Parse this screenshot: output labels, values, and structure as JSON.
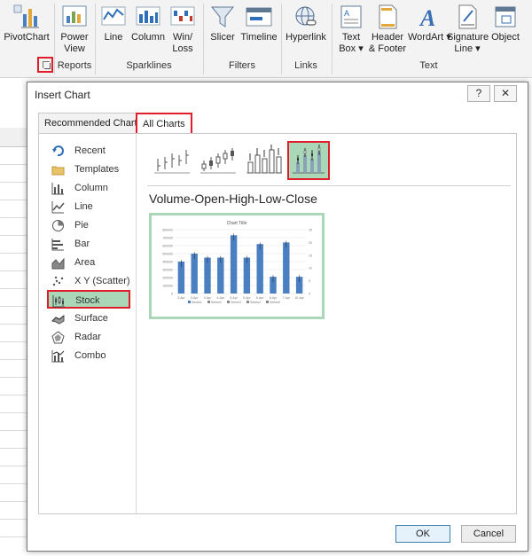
{
  "ribbon": {
    "buttons": [
      {
        "id": "pivotchart",
        "label": "PivotChart",
        "label2": ""
      },
      {
        "id": "power-view",
        "label": "Power",
        "label2": "View"
      },
      {
        "id": "line",
        "label": "Line",
        "label2": ""
      },
      {
        "id": "column",
        "label": "Column",
        "label2": ""
      },
      {
        "id": "winloss",
        "label": "Win/",
        "label2": "Loss"
      },
      {
        "id": "slicer",
        "label": "Slicer",
        "label2": ""
      },
      {
        "id": "timeline",
        "label": "Timeline",
        "label2": ""
      },
      {
        "id": "hyperlink",
        "label": "Hyperlink",
        "label2": ""
      },
      {
        "id": "textbox",
        "label": "Text",
        "label2": "Box ▾"
      },
      {
        "id": "header-footer",
        "label": "Header",
        "label2": "& Footer"
      },
      {
        "id": "wordart",
        "label": "WordArt ▾",
        "label2": ""
      },
      {
        "id": "signature-line",
        "label": "Signature",
        "label2": "Line ▾"
      },
      {
        "id": "object",
        "label": "Object",
        "label2": ""
      }
    ],
    "groups": {
      "reports": "Reports",
      "sparklines": "Sparklines",
      "filters": "Filters",
      "links": "Links",
      "text": "Text"
    }
  },
  "dialog": {
    "title": "Insert Chart",
    "help_label": "?",
    "close_label": "✕",
    "tabs": {
      "recommended": "Recommended Charts",
      "all": "All Charts"
    },
    "sidebar": [
      {
        "label": "Recent",
        "icon": "recent-icon"
      },
      {
        "label": "Templates",
        "icon": "folder-icon"
      },
      {
        "label": "Column",
        "icon": "column-chart-icon"
      },
      {
        "label": "Line",
        "icon": "line-chart-icon"
      },
      {
        "label": "Pie",
        "icon": "pie-chart-icon"
      },
      {
        "label": "Bar",
        "icon": "bar-chart-icon"
      },
      {
        "label": "Area",
        "icon": "area-chart-icon"
      },
      {
        "label": "X Y (Scatter)",
        "icon": "scatter-chart-icon"
      },
      {
        "label": "Stock",
        "icon": "stock-chart-icon"
      },
      {
        "label": "Surface",
        "icon": "surface-chart-icon"
      },
      {
        "label": "Radar",
        "icon": "radar-chart-icon"
      },
      {
        "label": "Combo",
        "icon": "combo-chart-icon"
      }
    ],
    "selected_category": "Stock",
    "selected_subtype_name": "Volume-Open-High-Low-Close",
    "preview": {
      "chart_title": "Chart Title",
      "volume_values": [
        400000,
        500000,
        450000,
        450000,
        730000,
        450000,
        620000,
        210000,
        640000,
        210000
      ],
      "categories": [
        "3-Apr",
        "3-Apr",
        "4-Apr",
        "4-Apr",
        "5-Apr",
        "5-Apr",
        "6-Apr",
        "6-Apr",
        "7-Apr",
        "10-Apr"
      ],
      "left_axis_ticks": [
        "800000",
        "700000",
        "600000",
        "500000",
        "400000",
        "300000",
        "200000",
        "100000",
        "0"
      ],
      "right_axis_ticks": [
        "25",
        "20",
        "15",
        "10",
        "5",
        "0"
      ],
      "legend": [
        "Series1",
        "Series2",
        "Series3",
        "Series4",
        "Series5"
      ]
    },
    "buttons": {
      "ok": "OK",
      "cancel": "Cancel"
    }
  },
  "colors": {
    "selected_fill": "#a9d7b8",
    "highlight_border": "#e01e2b",
    "bar_blue": "#4a7fc1"
  }
}
